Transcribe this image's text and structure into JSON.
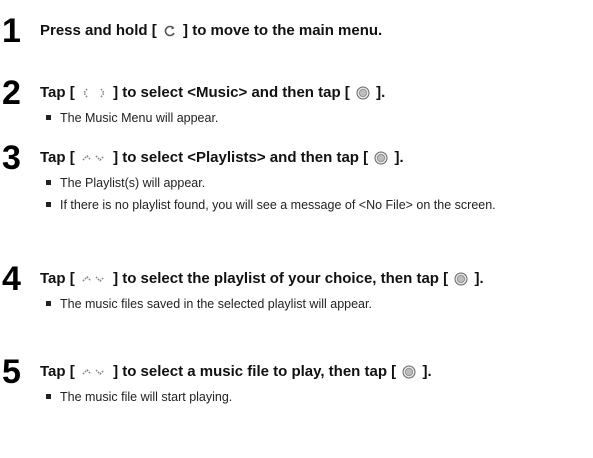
{
  "steps": [
    {
      "number": "1",
      "pre": "Press and hold [",
      "post": "] to move to the main menu.",
      "icons": [
        "back-icon"
      ],
      "bullets": []
    },
    {
      "number": "2",
      "pre": "Tap [",
      "mid": "] to select <Music> and then tap [",
      "post": "].",
      "icons": [
        "left-right-arrows-icon",
        "select-button-icon"
      ],
      "bullets": [
        "The Music Menu will appear."
      ]
    },
    {
      "number": "3",
      "pre": "Tap [",
      "mid": "] to select <Playlists> and then tap [",
      "post": "].",
      "icons": [
        "up-down-arrows-icon",
        "select-button-icon"
      ],
      "bullets": [
        "The Playlist(s) will appear.",
        "If there is no playlist found, you will see a message of <No File> on the screen."
      ]
    },
    {
      "number": "4",
      "pre": "Tap [",
      "mid": "] to select the playlist of your choice, then tap [",
      "post": "].",
      "icons": [
        "up-down-arrows-icon",
        "select-button-icon"
      ],
      "bullets": [
        "The music files saved in the selected playlist will appear."
      ]
    },
    {
      "number": "5",
      "pre": "Tap [",
      "mid": "] to select a music file to play, then tap [",
      "post": "].",
      "icons": [
        "up-down-arrows-icon",
        "select-button-icon"
      ],
      "bullets": [
        "The music file will start playing."
      ]
    }
  ]
}
